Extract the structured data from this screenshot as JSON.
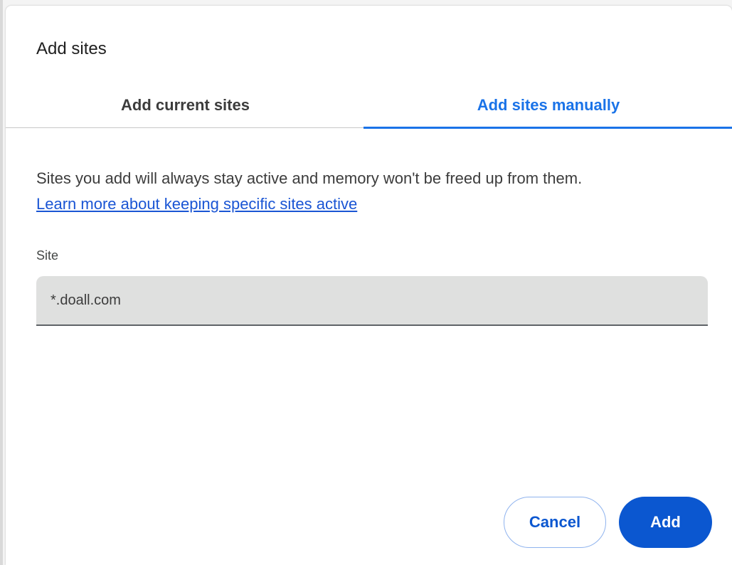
{
  "dialog": {
    "title": "Add sites"
  },
  "tabs": [
    {
      "label": "Add current sites",
      "selected": false
    },
    {
      "label": "Add sites manually",
      "selected": true
    }
  ],
  "content": {
    "description": "Sites you add will always stay active and memory won't be freed up from them.",
    "learn_more_link": "Learn more about keeping specific sites active"
  },
  "site_field": {
    "label": "Site",
    "value": "*.doall.com"
  },
  "actions": {
    "cancel_label": "Cancel",
    "add_label": "Add"
  },
  "colors": {
    "accent": "#1a73e8",
    "primary_button": "#0b57d0",
    "link": "#1a55d4",
    "input_background": "#dfe0df"
  }
}
